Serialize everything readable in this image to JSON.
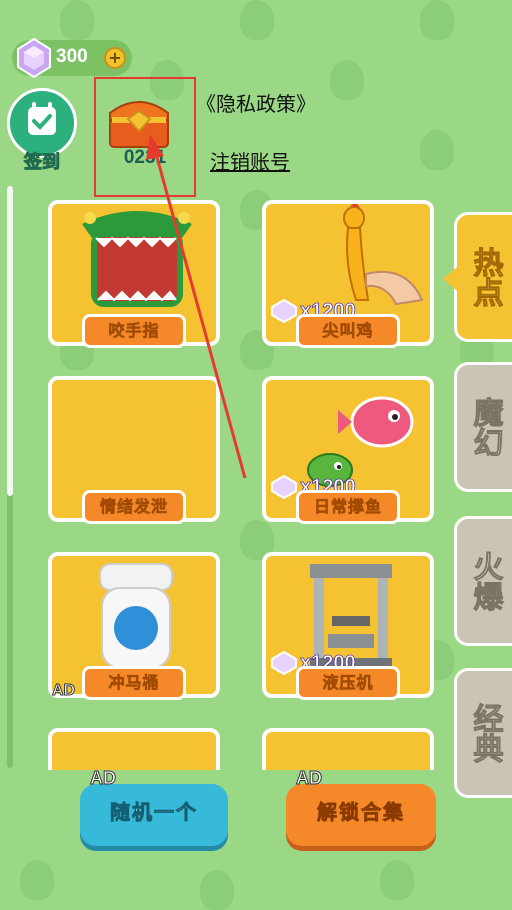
{
  "header": {
    "gem_count": "300",
    "plus_label": "+",
    "signin_label": "签到",
    "chest_code": "0231",
    "privacy_link": "《隐私政策》",
    "logout_link": "注销账号"
  },
  "cards": [
    {
      "label": "咬手指",
      "price": ""
    },
    {
      "label": "尖叫鸡",
      "price": "x1200"
    },
    {
      "label": "情绪发泄",
      "price": ""
    },
    {
      "label": "日常撑鱼",
      "price": "x1200"
    },
    {
      "label": "冲马桶",
      "price": "",
      "ad": "AD"
    },
    {
      "label": "液压机",
      "price": "x1200"
    }
  ],
  "tabs": [
    {
      "label": "热点",
      "active": true
    },
    {
      "label": "魔幻",
      "active": false
    },
    {
      "label": "火爆",
      "active": false
    },
    {
      "label": "经典",
      "active": false
    }
  ],
  "bottom": {
    "random_ad": "AD",
    "random_label": "随机一个",
    "unlock_ad": "AD",
    "unlock_label": "解锁合集"
  },
  "colors": {
    "background": "#9bd886",
    "card": "#f5c232",
    "label": "#f5892a",
    "annotation": "#e53b2f"
  }
}
